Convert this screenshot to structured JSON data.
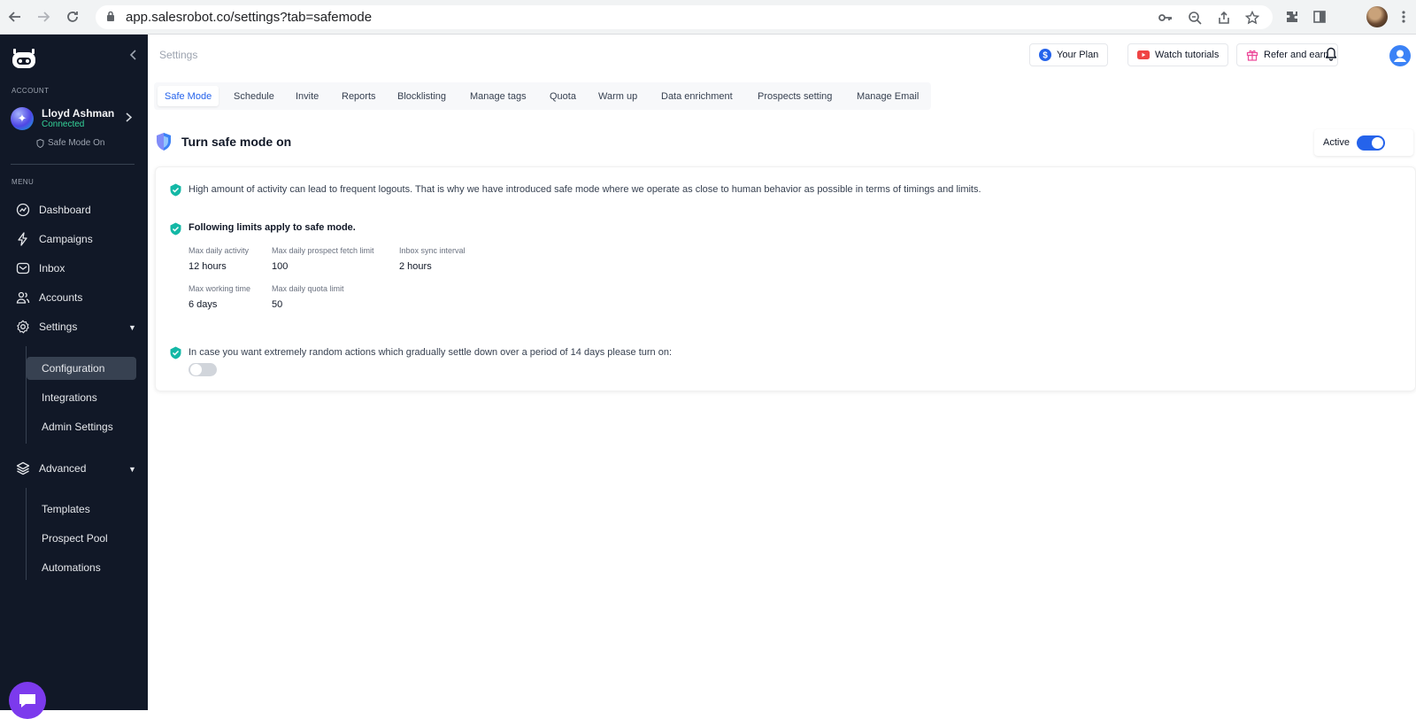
{
  "browser": {
    "url": "app.salesrobot.co/settings?tab=safemode"
  },
  "sidebar": {
    "account_label": "ACCOUNT",
    "account_name": "Lloyd Ashman",
    "account_status": "Connected",
    "safe_mode_status": "Safe Mode On",
    "menu_label": "MENU",
    "menu": [
      {
        "label": "Dashboard",
        "icon": "chart-icon"
      },
      {
        "label": "Campaigns",
        "icon": "bolt-icon"
      },
      {
        "label": "Inbox",
        "icon": "inbox-icon"
      },
      {
        "label": "Accounts",
        "icon": "users-icon"
      },
      {
        "label": "Settings",
        "icon": "gear-icon"
      }
    ],
    "settings_sub": [
      "Configuration",
      "Integrations",
      "Admin Settings"
    ],
    "advanced_label": "Advanced",
    "advanced_sub": [
      "Templates",
      "Prospect Pool",
      "Automations"
    ]
  },
  "header": {
    "breadcrumb": "Settings",
    "your_plan": "Your Plan",
    "watch_tutorials": "Watch tutorials",
    "refer_and_earn": "Refer and earn"
  },
  "tabs": [
    "Safe Mode",
    "Schedule",
    "Invite",
    "Reports",
    "Blocklisting",
    "Manage tags",
    "Quota",
    "Warm up",
    "Data enrichment",
    "Prospects setting",
    "Manage Email"
  ],
  "safe_mode": {
    "title": "Turn safe mode on",
    "active_label": "Active",
    "active": true,
    "intro": "High amount of activity can lead to frequent logouts. That is why we have introduced safe mode where we operate as close to human behavior as possible in terms of timings and limits.",
    "limits_heading": "Following limits apply to safe mode.",
    "limits": [
      {
        "label": "Max daily activity",
        "value": "12 hours"
      },
      {
        "label": "Max daily prospect fetch limit",
        "value": "100"
      },
      {
        "label": "Inbox sync interval",
        "value": "2 hours"
      },
      {
        "label": "Max working time",
        "value": "6 days"
      },
      {
        "label": "Max daily quota limit",
        "value": "50"
      }
    ],
    "random_text": "In case you want extremely random actions which gradually settle down over a period of 14 days please turn on:",
    "random_enabled": false
  },
  "colors": {
    "sidebar_bg": "#111827",
    "accent": "#2563eb",
    "check": "#14b8a6",
    "connected": "#34d399"
  }
}
